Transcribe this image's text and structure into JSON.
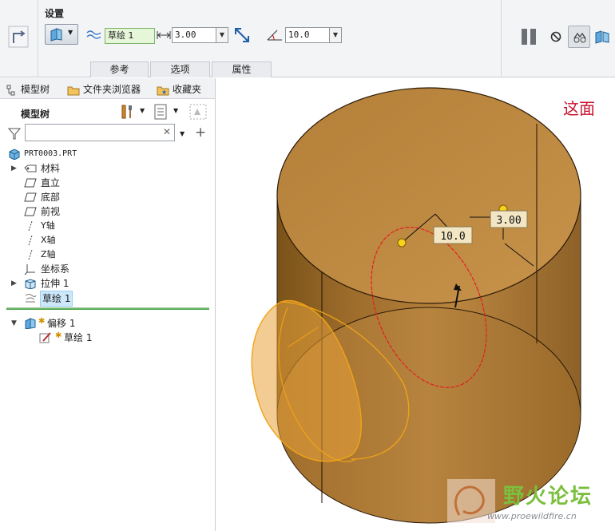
{
  "dashboard": {
    "settings_label": "设置",
    "sketch_name": "草绘 1",
    "offset_value": "3.00",
    "angle_value": "10.0",
    "tabs": [
      {
        "label": "参考"
      },
      {
        "label": "选项"
      },
      {
        "label": "属性"
      }
    ]
  },
  "panel": {
    "tabs": [
      {
        "label": "模型树",
        "icon": "model-tree-icon"
      },
      {
        "label": "文件夹浏览器",
        "icon": "folder-browser-icon"
      },
      {
        "label": "收藏夹",
        "icon": "favorites-icon"
      }
    ],
    "title": "模型树",
    "filter_placeholder": "",
    "items": [
      {
        "label": "PRT0003.PRT",
        "icon": "part-icon"
      },
      {
        "label": "材料",
        "icon": "material-icon"
      },
      {
        "label": "直立",
        "icon": "datum-plane-icon"
      },
      {
        "label": "底部",
        "icon": "datum-plane-icon"
      },
      {
        "label": "前视",
        "icon": "datum-plane-icon"
      },
      {
        "label": "Y轴",
        "icon": "axis-icon"
      },
      {
        "label": "X轴",
        "icon": "axis-icon"
      },
      {
        "label": "Z轴",
        "icon": "axis-icon"
      },
      {
        "label": "坐标系",
        "icon": "csys-icon"
      },
      {
        "label": "拉伸 1",
        "icon": "extrude-icon"
      },
      {
        "label": "草绘 1",
        "icon": "sketch-icon"
      },
      {
        "label": "偏移 1",
        "icon": "offset-icon"
      },
      {
        "label": "草绘 1",
        "icon": "sketch-edit-icon"
      }
    ]
  },
  "viewport": {
    "dim_angle": "10.0",
    "dim_offset": "3.00",
    "annotation": "这面",
    "watermark_cn": "野火论坛",
    "watermark_url": "www.proewildfire.cn"
  },
  "colors": {
    "solid": "#b5813a",
    "highlight_sketch": "#e8a81e",
    "dimension_sketch": "#e02020",
    "annotation": "#c8102e"
  }
}
